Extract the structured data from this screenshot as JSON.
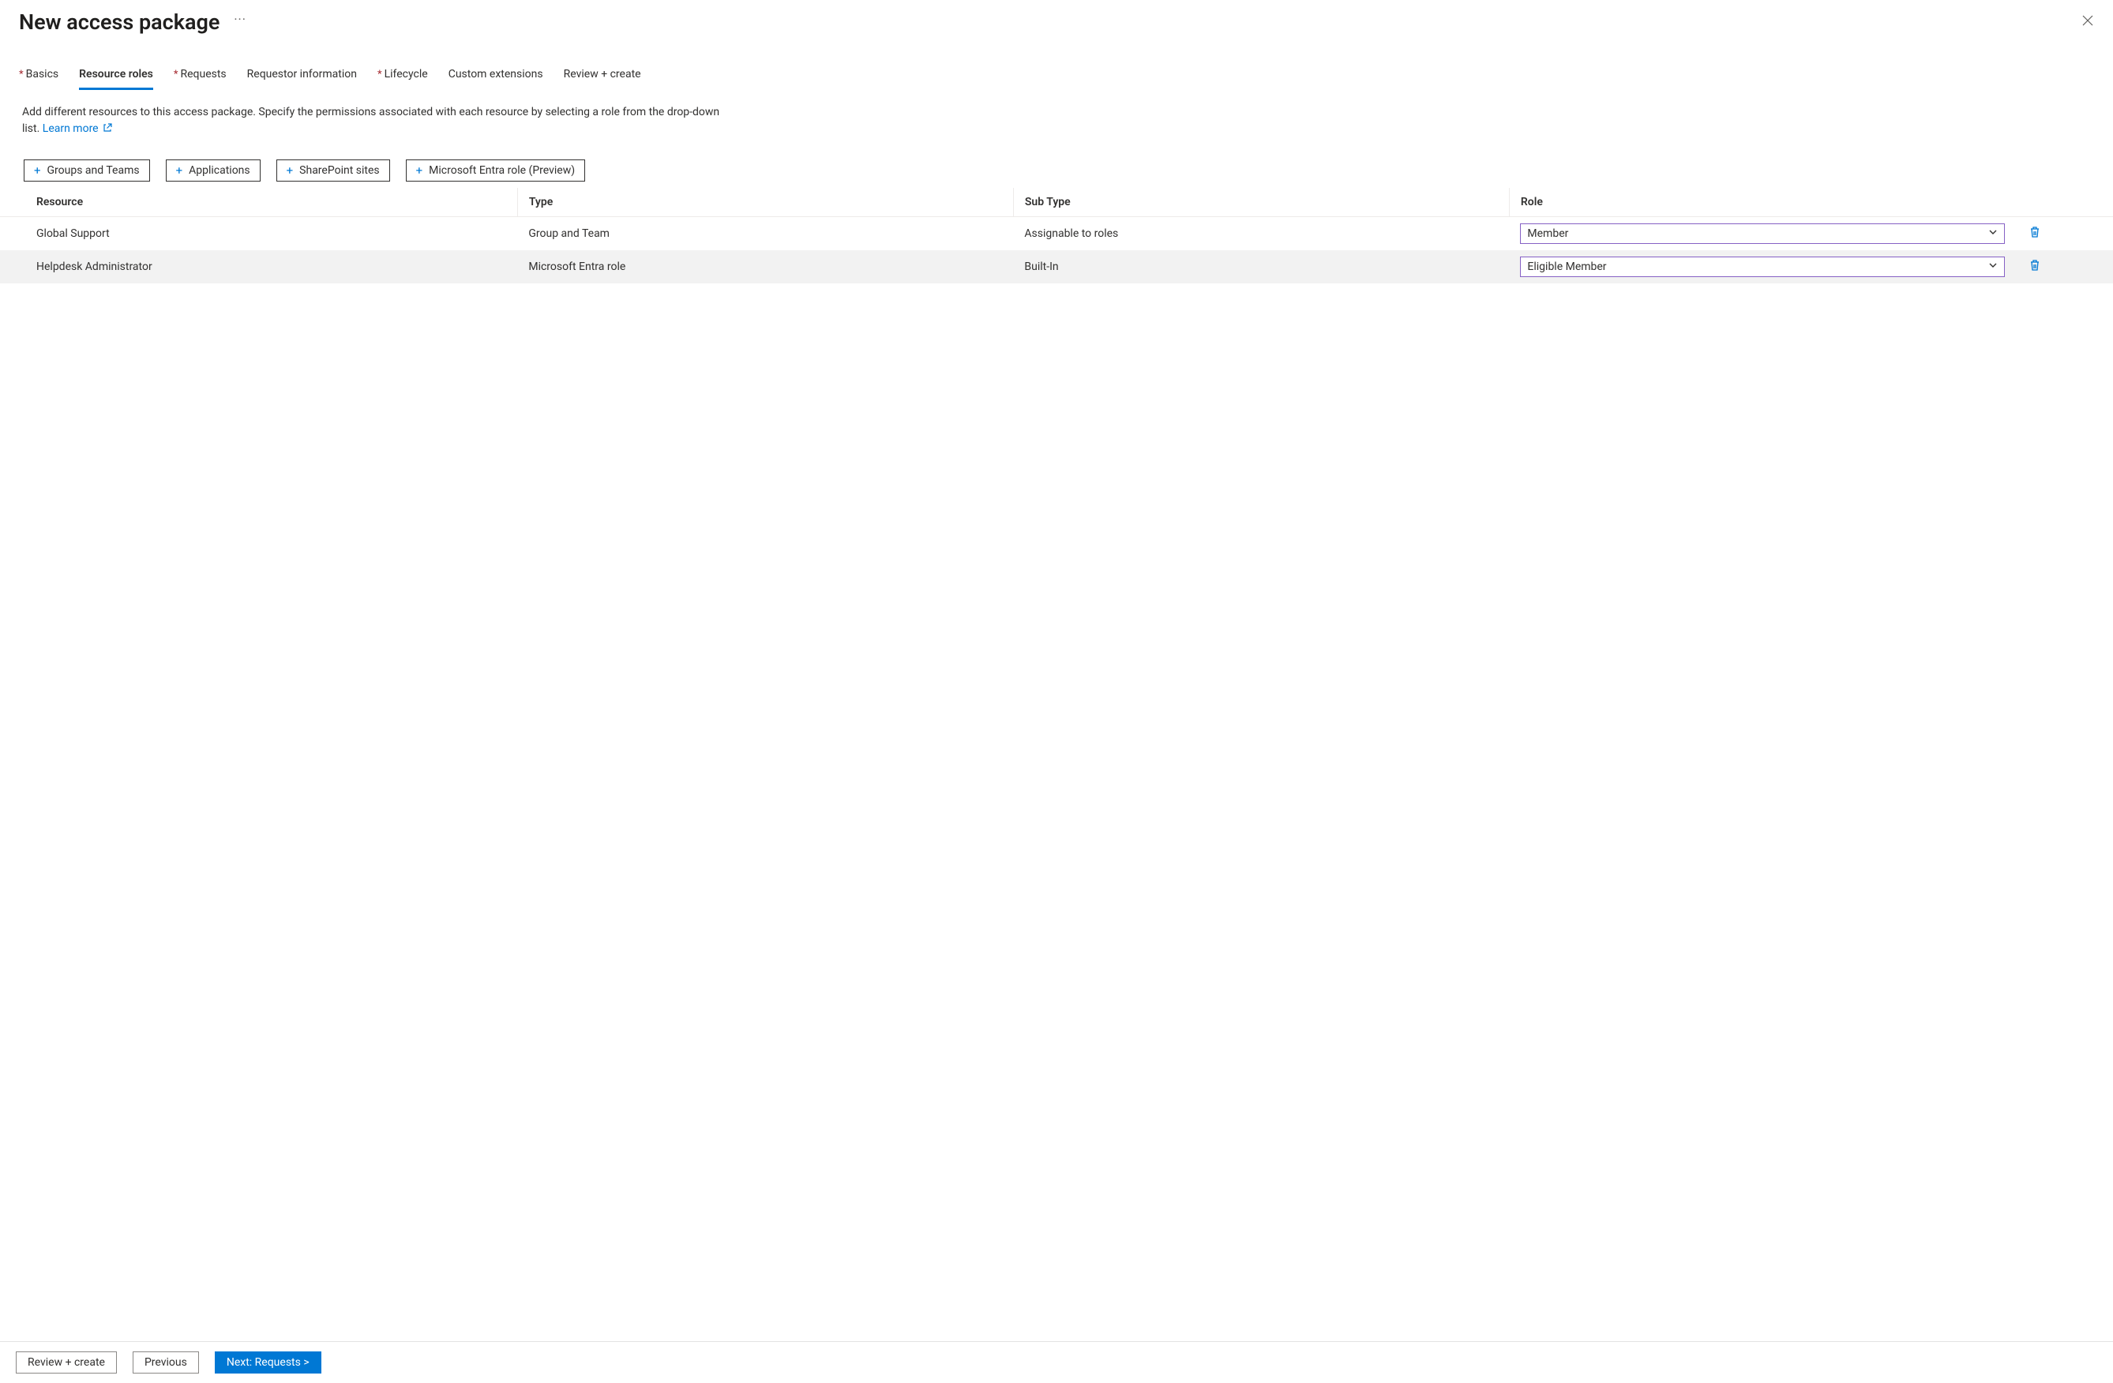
{
  "header": {
    "title": "New access package",
    "more_label": "···"
  },
  "tabs": [
    {
      "label": "Basics",
      "required": true,
      "active": false
    },
    {
      "label": "Resource roles",
      "required": false,
      "active": true
    },
    {
      "label": "Requests",
      "required": true,
      "active": false
    },
    {
      "label": "Requestor information",
      "required": false,
      "active": false
    },
    {
      "label": "Lifecycle",
      "required": true,
      "active": false
    },
    {
      "label": "Custom extensions",
      "required": false,
      "active": false
    },
    {
      "label": "Review + create",
      "required": false,
      "active": false
    }
  ],
  "description": {
    "text": "Add different resources to this access package. Specify the permissions associated with each resource by selecting a role from the drop-down list. ",
    "link_label": "Learn more"
  },
  "toolbar": {
    "groups": "Groups and Teams",
    "apps": "Applications",
    "sites": "SharePoint sites",
    "entra_role": "Microsoft Entra role (Preview)"
  },
  "table": {
    "columns": {
      "resource": "Resource",
      "type": "Type",
      "subtype": "Sub Type",
      "role": "Role"
    },
    "rows": [
      {
        "resource": "Global Support",
        "type": "Group and Team",
        "subtype": "Assignable to roles",
        "role": "Member"
      },
      {
        "resource": "Helpdesk Administrator",
        "type": "Microsoft Entra role",
        "subtype": "Built-In",
        "role": "Eligible Member"
      }
    ]
  },
  "footer": {
    "review": "Review + create",
    "previous": "Previous",
    "next": "Next: Requests >"
  }
}
